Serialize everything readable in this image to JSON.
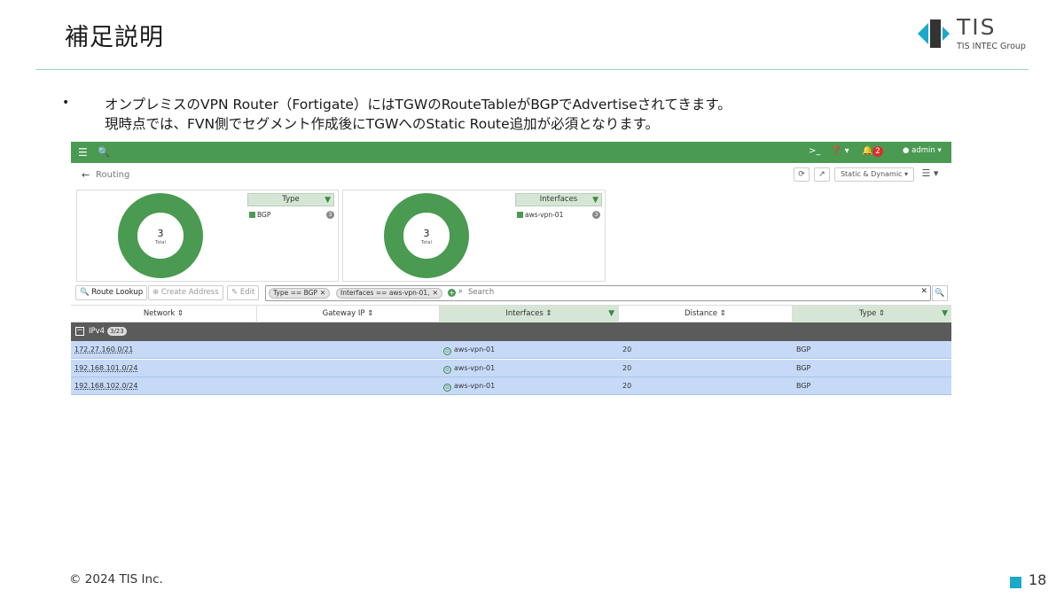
{
  "slide": {
    "title": "補足説明",
    "logo_main": "TIS",
    "logo_sub": "TIS INTEC Group",
    "bullet_marker": "•",
    "bullet_line1": "オンプレミスのVPN Router（Fortigate）にはTGWのRouteTableがBGPでAdvertiseされてきます。",
    "bullet_line2": "現時点では、FVN側でセグメント作成後にTGWへのStatic Route追加が必須となります。",
    "copyright": "© 2024 TIS Inc.",
    "page_number": "18",
    "accent_color": "#1aa9c7"
  },
  "app": {
    "topbar_color": "#4a9a52",
    "menu_icon": "☰",
    "search_icon": "🔍",
    "cli_label": ">_",
    "help_label": "❓ ▾",
    "bell_label": "🔔",
    "notification_count": "2",
    "user_label": "● admin ▾",
    "back_label": "←",
    "breadcrumb": "Routing",
    "view_mode": "Static & Dynamic ▾",
    "refresh_icon": "⟳",
    "open_icon": "↗",
    "list_menu": "☰ ▾"
  },
  "widgets": {
    "type": {
      "total": "3",
      "total_label": "Total",
      "header": "Type",
      "legend_label": "BGP",
      "legend_count": "3"
    },
    "interfaces": {
      "total": "3",
      "total_label": "Total",
      "header": "Interfaces",
      "legend_label": "aws-vpn-01",
      "legend_count": "3"
    }
  },
  "toolbar": {
    "route_lookup": "🔍 Route Lookup",
    "create_address": "⊕ Create Address",
    "edit": "✎ Edit",
    "chip_type": "Type == BGP",
    "chip_interfaces": "Interfaces == aws-vpn-01,",
    "chip_close": "✕",
    "search_placeholder": "Search",
    "search_value": "",
    "clear": "✕",
    "search_button": "🔍"
  },
  "table": {
    "headers": [
      "Network ⇕",
      "Gateway IP ⇕",
      "Interfaces ⇕",
      "Distance ⇕",
      "Type ⇕"
    ],
    "group_label": "IPv4",
    "group_count": "3/23",
    "group_toggle": "−",
    "rows": [
      {
        "network": "172.27.160.0/21",
        "gateway": "",
        "interface": "aws-vpn-01",
        "distance": "20",
        "type": "BGP"
      },
      {
        "network": "192.168.101.0/24",
        "gateway": "",
        "interface": "aws-vpn-01",
        "distance": "20",
        "type": "BGP"
      },
      {
        "network": "192.168.102.0/24",
        "gateway": "",
        "interface": "aws-vpn-01",
        "distance": "20",
        "type": "BGP"
      }
    ]
  }
}
